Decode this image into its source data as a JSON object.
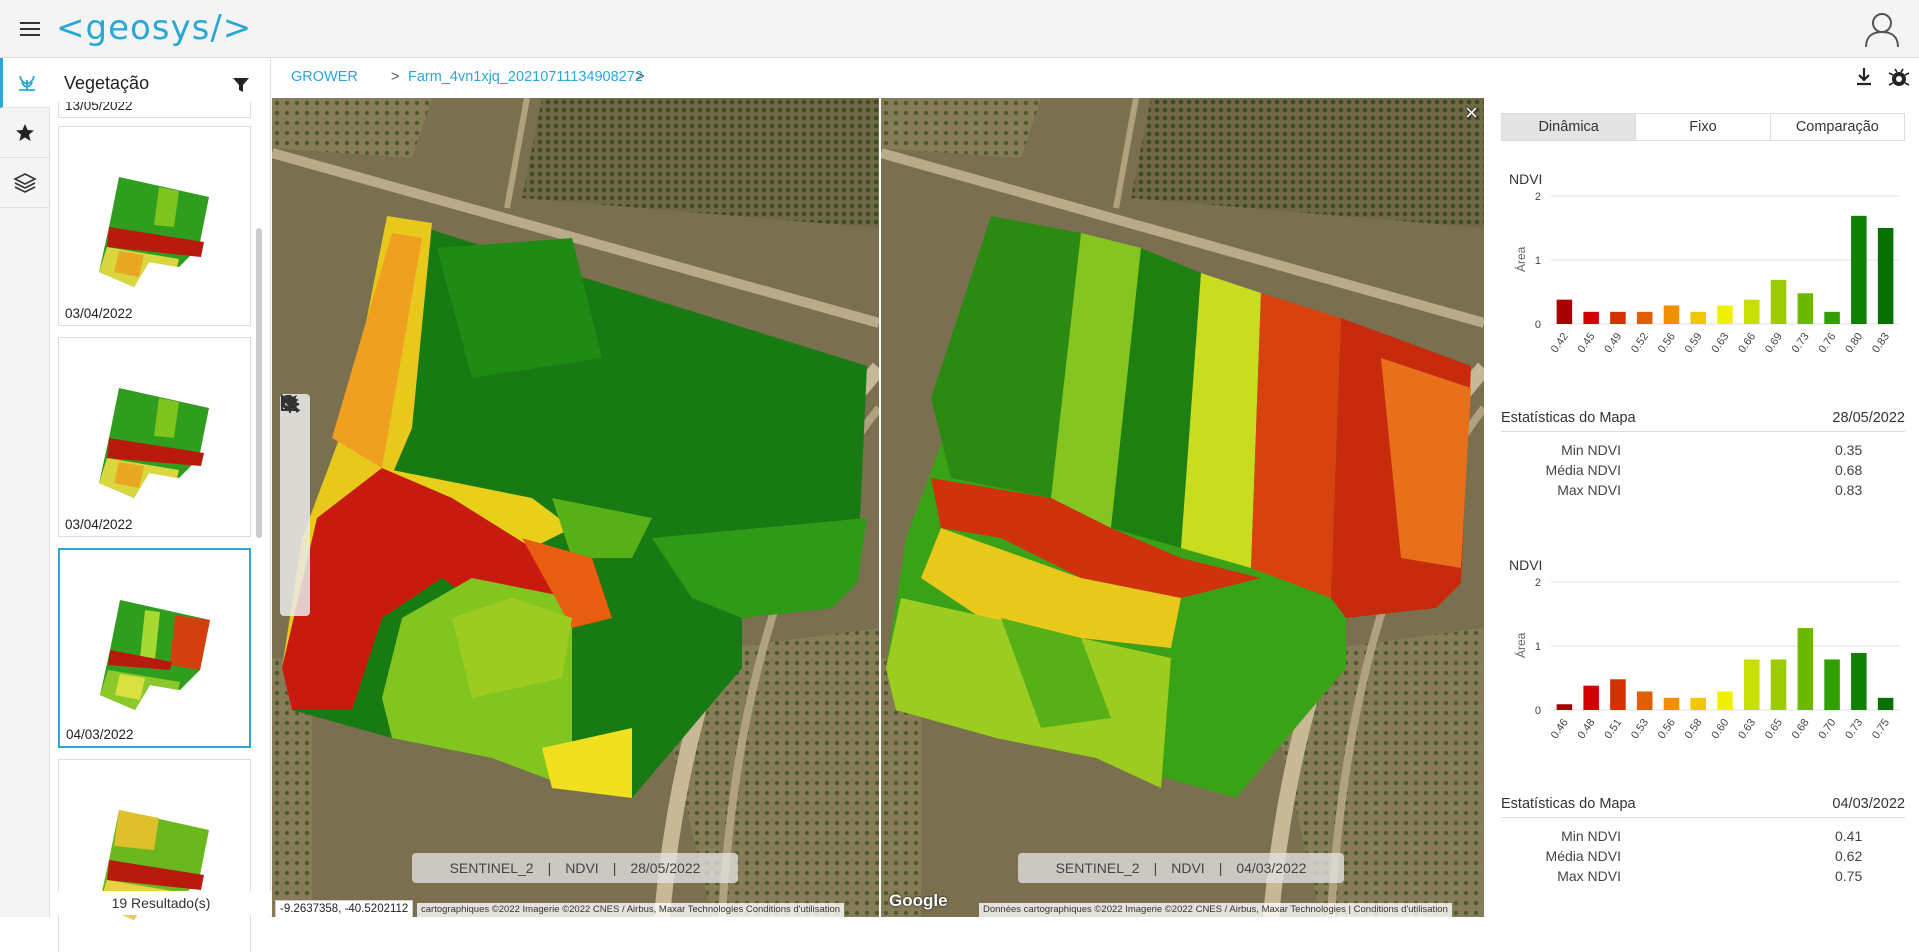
{
  "app": {
    "logo_text": "<geosys/>"
  },
  "sidebar_panel": {
    "title": "Vegetação",
    "cards": [
      {
        "date": "13/05/2022",
        "selected": false
      },
      {
        "date": "03/04/2022",
        "selected": false
      },
      {
        "date": "03/04/2022",
        "selected": false
      },
      {
        "date": "04/03/2022",
        "selected": true
      },
      {
        "date": "",
        "selected": false
      }
    ],
    "results": "19 Resultado(s)"
  },
  "breadcrumb": {
    "root": "GROWER",
    "sep1": ">",
    "farm": "Farm_4vn1xjq_20210711134908272",
    "sep2": ">"
  },
  "map_left": {
    "label": {
      "sensor": "SENTINEL_2",
      "index": "NDVI",
      "date": "28/05/2022",
      "sep": "|"
    },
    "coords": "-9.2637358, -40.5202112",
    "attribution": "cartographiques ©2022 Imagerie ©2022 CNES / Airbus, Maxar Technologies     Conditions d'utilisation"
  },
  "map_right": {
    "label": {
      "sensor": "SENTINEL_2",
      "index": "NDVI",
      "date": "04/03/2022",
      "sep": "|"
    },
    "google": "Google",
    "attribution": "Données cartographiques ©2022 Imagerie ©2022 CNES / Airbus, Maxar Technologies  |  Conditions d'utilisation"
  },
  "tabs": [
    "Dinâmica",
    "Fixo",
    "Comparação"
  ],
  "histograms": [
    {
      "title": "NDVI",
      "ylabel": "Área",
      "ylim": [
        0,
        2
      ],
      "yticks": [
        "0",
        "1",
        "2"
      ],
      "chart_data": {
        "type": "bar",
        "categories": [
          "0.42",
          "0.45",
          "0.49",
          "0.52",
          "0.56",
          "0.59",
          "0.63",
          "0.66",
          "0.69",
          "0.73",
          "0.76",
          "0.80",
          "0.83"
        ],
        "values": [
          0.38,
          0.19,
          0.19,
          0.19,
          0.29,
          0.19,
          0.29,
          0.38,
          0.69,
          0.48,
          0.19,
          1.69,
          1.5
        ],
        "colors": [
          "#a80000",
          "#d40000",
          "#d43000",
          "#e06000",
          "#f09000",
          "#f0c800",
          "#f0f000",
          "#c8e000",
          "#9ccc00",
          "#6cb800",
          "#30a000",
          "#108000",
          "#087000"
        ]
      },
      "stats_title": "Estatísticas do Mapa",
      "stats_date": "28/05/2022",
      "stats": [
        {
          "k": "Min NDVI",
          "v": "0.35"
        },
        {
          "k": "Média NDVI",
          "v": "0.68"
        },
        {
          "k": "Max NDVI",
          "v": "0.83"
        }
      ]
    },
    {
      "title": "NDVI",
      "ylabel": "Área",
      "ylim": [
        0,
        2
      ],
      "yticks": [
        "0",
        "1",
        "2"
      ],
      "chart_data": {
        "type": "bar",
        "categories": [
          "0.46",
          "0.48",
          "0.51",
          "0.53",
          "0.56",
          "0.58",
          "0.60",
          "0.63",
          "0.65",
          "0.68",
          "0.70",
          "0.73",
          "0.75"
        ],
        "values": [
          0.09,
          0.38,
          0.48,
          0.29,
          0.19,
          0.19,
          0.29,
          0.79,
          0.79,
          1.28,
          0.79,
          0.89,
          0.19
        ],
        "colors": [
          "#a80000",
          "#d40000",
          "#d43000",
          "#e06000",
          "#f09000",
          "#f0c800",
          "#f0f000",
          "#c8e000",
          "#9ccc00",
          "#6cb800",
          "#30a000",
          "#108000",
          "#087000"
        ]
      },
      "stats_title": "Estatísticas do Mapa",
      "stats_date": "04/03/2022",
      "stats": [
        {
          "k": "Min NDVI",
          "v": "0.41"
        },
        {
          "k": "Média NDVI",
          "v": "0.62"
        },
        {
          "k": "Max NDVI",
          "v": "0.75"
        }
      ]
    }
  ],
  "colors": {
    "accent": "#2aa7d4"
  }
}
